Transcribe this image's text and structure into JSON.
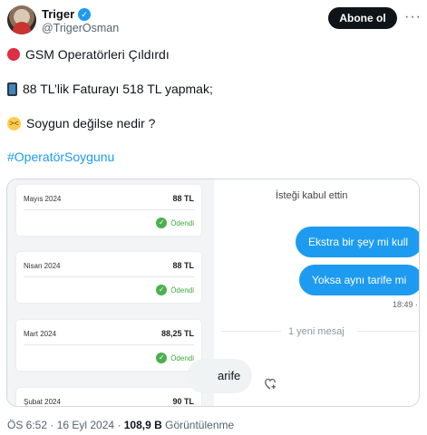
{
  "author": {
    "name": "Triger",
    "handle": "@TrigerOsman",
    "verified_mark": "✓"
  },
  "header": {
    "follow_label": "Abone ol",
    "more_label": "···"
  },
  "tweet": {
    "lines": [
      {
        "icon": "red-circle-emoji",
        "text": "GSM Operatörleri Çıldırdı"
      },
      {
        "icon": "mobile-phone-emoji",
        "text": "88 TL’lik Faturayı  518 TL yapmak;"
      },
      {
        "icon": "steaming-face-emoji",
        "text": "Soygun değilse nedir ?"
      }
    ],
    "hashtag": "#OperatörSoygunu"
  },
  "media": {
    "bills": [
      {
        "month": "Mayıs 2024",
        "amount": "88 TL",
        "status": "Ödendi"
      },
      {
        "month": "Nisan 2024",
        "amount": "88 TL",
        "status": "Ödendi"
      },
      {
        "month": "Mart 2024",
        "amount": "88,25 TL",
        "status": "Ödendi"
      },
      {
        "month": "Şubat 2024",
        "amount": "90 TL",
        "status": ""
      }
    ],
    "chat": {
      "accepted": "İsteği kabul ettin",
      "messages": [
        "Ekstra bir şey mi kull",
        "Yoksa aynı tarife mi"
      ],
      "time": "18:49 · ",
      "new_messages": "1 yeni mesaj",
      "incoming": "arife"
    }
  },
  "footer": {
    "timestamp": "ÖS 6:52 · 16 Eyl 2024 · ",
    "views_count": "108,9 B",
    "views_label": " Görüntülenme"
  },
  "colors": {
    "accent": "#1d9bf0",
    "follow_bg": "#0f1419",
    "paid_green": "#4caf50"
  }
}
